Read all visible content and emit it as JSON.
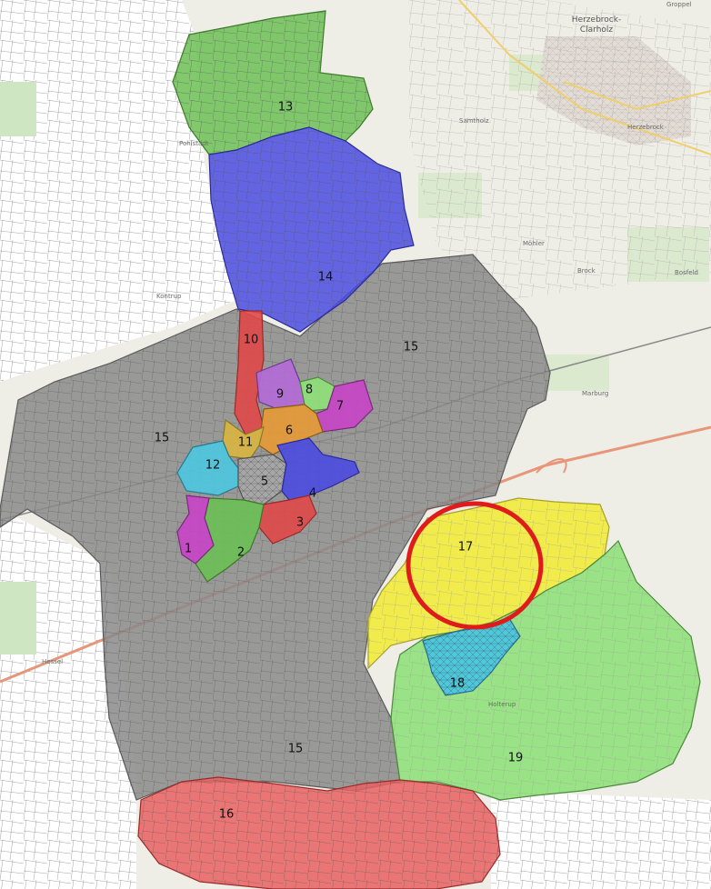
{
  "map": {
    "colors": {
      "background": "#f1efe8",
      "gray": "#8a8a8a",
      "green": "#6cbf55",
      "blue": "#4a4be0",
      "red": "#e04848",
      "purple": "#b46ad8",
      "orange": "#e79a35",
      "cyan": "#4cc6e0",
      "yellow": "#f1ea3a",
      "lightgreen": "#8fe07a",
      "magenta": "#c844c8",
      "olive": "#d9b640",
      "highlight": "#e01b1b",
      "motorway": "#e7967a"
    },
    "districts": [
      {
        "id": "15",
        "label": "15",
        "color": "gray"
      },
      {
        "id": "13",
        "label": "13",
        "color": "green"
      },
      {
        "id": "14",
        "label": "14",
        "color": "blue"
      },
      {
        "id": "10",
        "label": "10",
        "color": "red"
      },
      {
        "id": "9",
        "label": "9",
        "color": "purple"
      },
      {
        "id": "8",
        "label": "8",
        "color": "lightgreen"
      },
      {
        "id": "7",
        "label": "7",
        "color": "magenta"
      },
      {
        "id": "6",
        "label": "6",
        "color": "orange"
      },
      {
        "id": "11",
        "label": "11",
        "color": "olive"
      },
      {
        "id": "12",
        "label": "12",
        "color": "cyan"
      },
      {
        "id": "5",
        "label": "5",
        "color": "gray"
      },
      {
        "id": "4",
        "label": "4",
        "color": "blue"
      },
      {
        "id": "3",
        "label": "3",
        "color": "red"
      },
      {
        "id": "2",
        "label": "2",
        "color": "green"
      },
      {
        "id": "1",
        "label": "1",
        "color": "magenta"
      },
      {
        "id": "17",
        "label": "17",
        "color": "yellow"
      },
      {
        "id": "18",
        "label": "18",
        "color": "cyan"
      },
      {
        "id": "19",
        "label": "19",
        "color": "lightgreen"
      },
      {
        "id": "16",
        "label": "16",
        "color": "red"
      }
    ],
    "place_names": {
      "herzebrock_clarholz_1": "Herzebrock-",
      "herzebrock_clarholz_2": "Clarholz",
      "herzebrock": "Herzebrock",
      "samtholz": "Samtholz",
      "mohler": "Möhler",
      "brock": "Brock",
      "bosfeld": "Bosfeld",
      "marburg": "Marburg",
      "groppel": "Groppel",
      "pohlstadt": "Pohlstadt",
      "kontrup": "Kontrup",
      "hessel": "Hessel",
      "holterup": "Holterup"
    },
    "highlight": {
      "label": "highlight-circle"
    }
  }
}
